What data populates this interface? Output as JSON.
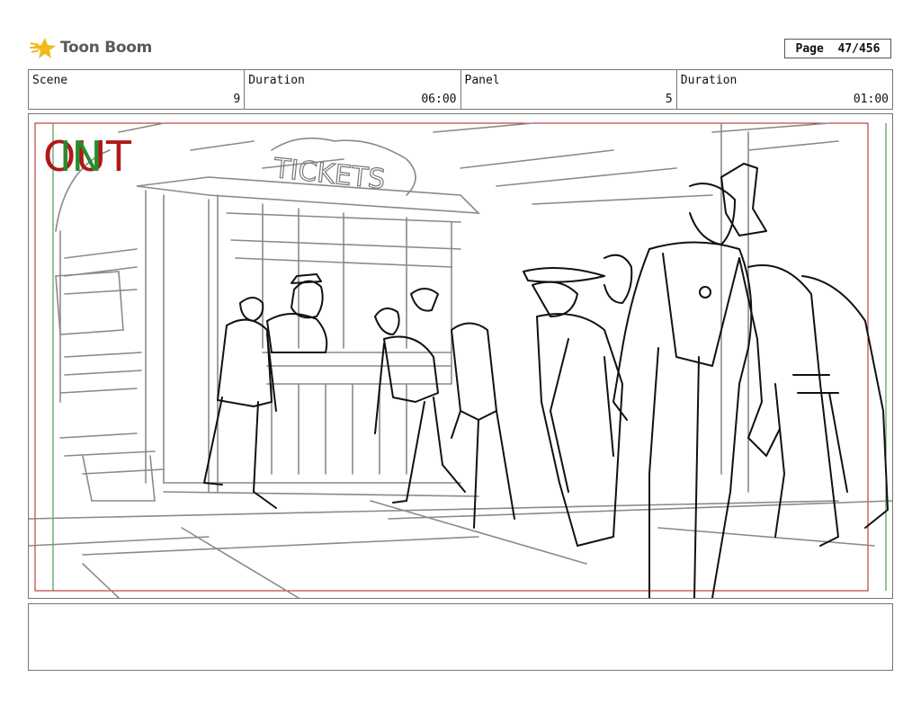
{
  "header": {
    "brand": "Toon Boom",
    "page_label": "Page",
    "page_value": "47/456"
  },
  "info": {
    "scene_label": "Scene",
    "scene_value": "9",
    "scene_duration_label": "Duration",
    "scene_duration_value": "06:00",
    "panel_label": "Panel",
    "panel_value": "5",
    "panel_duration_label": "Duration",
    "panel_duration_value": "01:00"
  },
  "panel": {
    "in_marker": "IN",
    "out_marker": "OUT",
    "sign_text": "TICKETS",
    "in_color": "#2a8a2a",
    "out_color": "#b01818"
  },
  "notes": {
    "text": ""
  }
}
